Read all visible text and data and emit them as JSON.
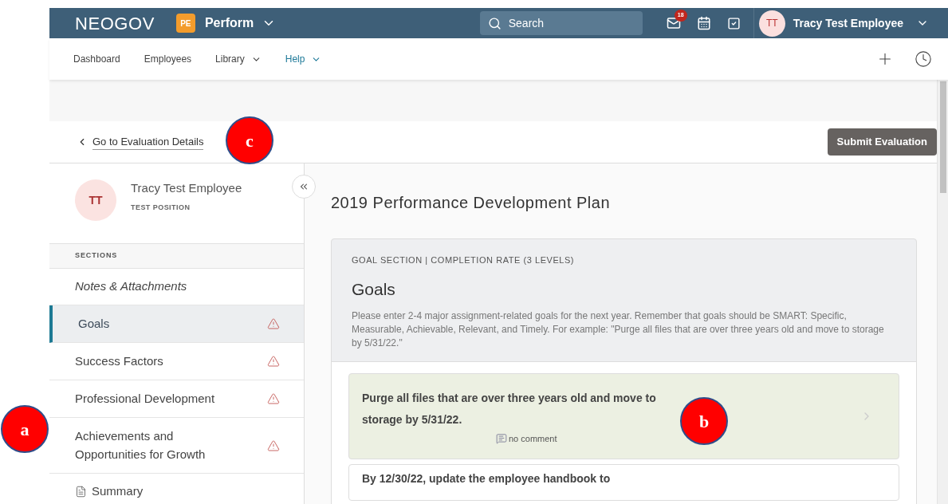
{
  "topbar": {
    "logo": "NEOGOV",
    "product_badge": "PE",
    "product": "Perform",
    "search": {
      "placeholder": "Search"
    },
    "inbox_count": "18",
    "user": {
      "initials": "TT",
      "name": "Tracy Test Employee"
    }
  },
  "nav": [
    {
      "label": "Dashboard",
      "dropdown": false,
      "selected": false
    },
    {
      "label": "Employees",
      "dropdown": false,
      "selected": false
    },
    {
      "label": "Library",
      "dropdown": true,
      "selected": false
    },
    {
      "label": "Help",
      "dropdown": true,
      "selected": true
    }
  ],
  "back_link": "Go to Evaluation Details",
  "submit_button": "Submit Evaluation",
  "employee": {
    "initials": "TT",
    "name": "Tracy Test Employee",
    "position": "TEST POSITION"
  },
  "sections_heading": "SECTIONS",
  "sections": [
    {
      "label": "Notes & Attachments",
      "kind": "notes",
      "selected": false
    },
    {
      "label": "Goals",
      "kind": "section",
      "selected": true,
      "warning": true
    },
    {
      "label": "Success Factors",
      "kind": "section",
      "selected": false,
      "warning": true
    },
    {
      "label": "Professional Development",
      "kind": "section",
      "selected": false,
      "warning": true
    },
    {
      "label": "Achievements and Opportunities for Growth",
      "kind": "section",
      "selected": false,
      "warning": true
    },
    {
      "label": "Summary",
      "kind": "summary",
      "selected": false
    }
  ],
  "plan_title": "2019 Performance Development Plan",
  "goal_section": {
    "eyebrow": "GOAL SECTION | COMPLETION RATE (3 LEVELS)",
    "title": "Goals",
    "description": "Please enter 2-4 major assignment-related goals for the next year. Remember that goals should be SMART: Specific, Measurable, Achievable, Relevant, and Timely. For example: \"Purge all files that are over three years old and move to storage by 5/31/22.\"",
    "goals": [
      {
        "text": "Purge all files that are over three years old and move to storage by 5/31/22.",
        "comment": "no comment",
        "highlighted": true
      },
      {
        "text": "By 12/30/22, update the employee handbook to",
        "highlighted": false
      }
    ]
  },
  "callouts": [
    {
      "label": "c"
    },
    {
      "label": "b"
    },
    {
      "label": "a"
    }
  ]
}
